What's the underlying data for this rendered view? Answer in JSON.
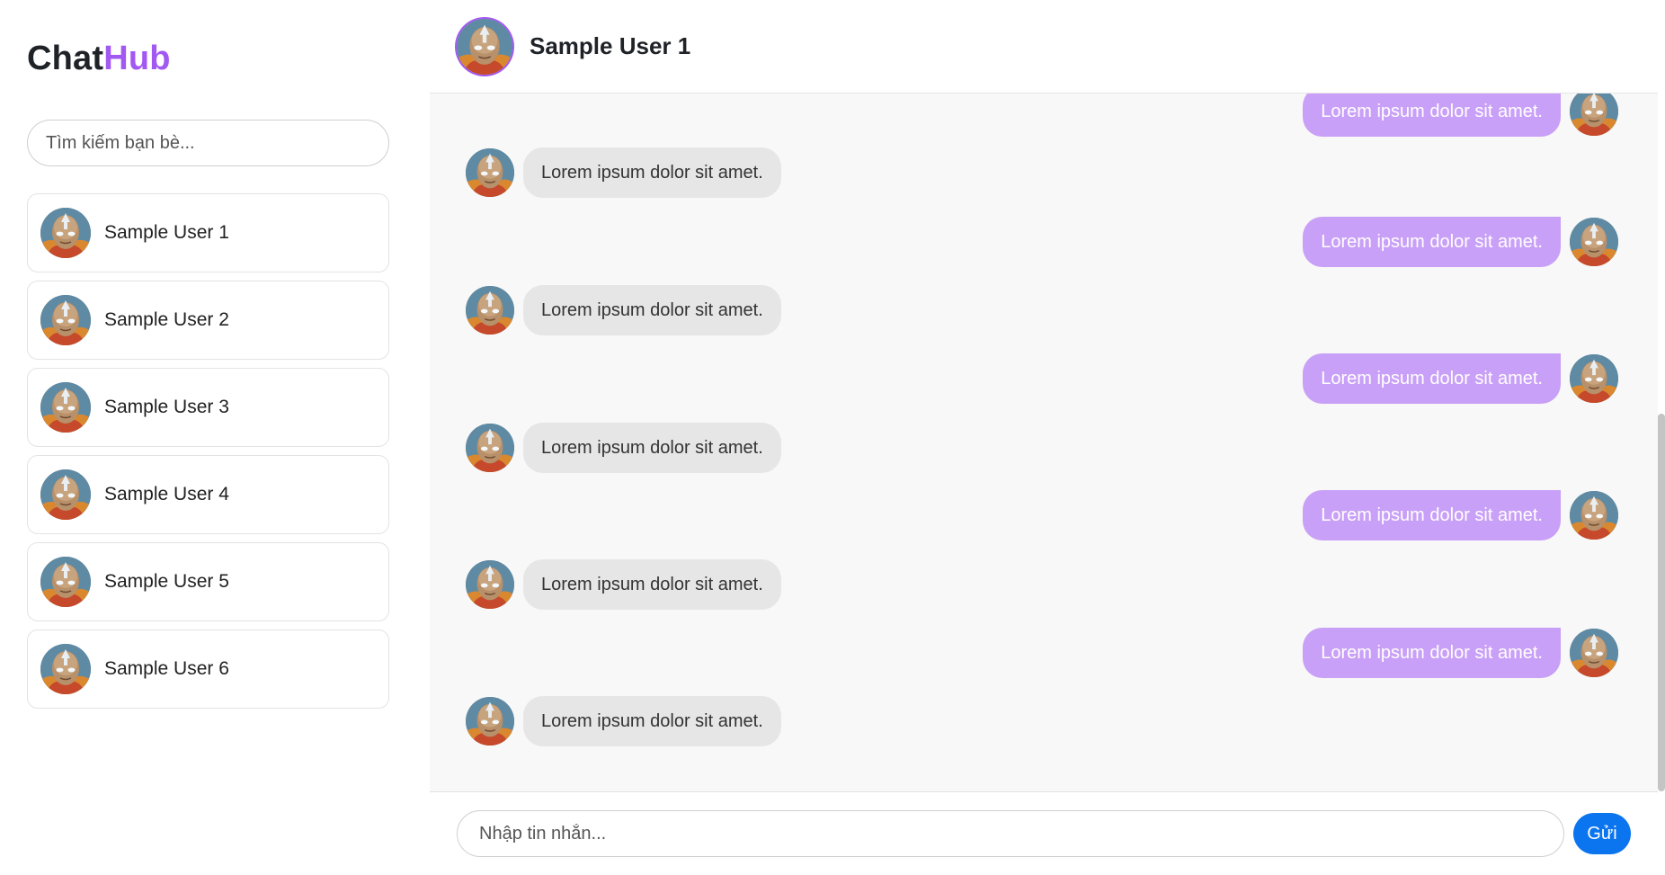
{
  "brand": {
    "part1": "Chat",
    "part2": "Hub"
  },
  "search": {
    "placeholder": "Tìm kiếm bạn bè..."
  },
  "users": [
    {
      "name": "Sample User 1"
    },
    {
      "name": "Sample User 2"
    },
    {
      "name": "Sample User 3"
    },
    {
      "name": "Sample User 4"
    },
    {
      "name": "Sample User 5"
    },
    {
      "name": "Sample User 6"
    }
  ],
  "chat": {
    "title": "Sample User 1",
    "messages": [
      {
        "dir": "out",
        "text": "Lorem ipsum dolor sit amet."
      },
      {
        "dir": "in",
        "text": "Lorem ipsum dolor sit amet."
      },
      {
        "dir": "out",
        "text": "Lorem ipsum dolor sit amet."
      },
      {
        "dir": "in",
        "text": "Lorem ipsum dolor sit amet."
      },
      {
        "dir": "out",
        "text": "Lorem ipsum dolor sit amet."
      },
      {
        "dir": "in",
        "text": "Lorem ipsum dolor sit amet."
      },
      {
        "dir": "out",
        "text": "Lorem ipsum dolor sit amet."
      },
      {
        "dir": "in",
        "text": "Lorem ipsum dolor sit amet."
      },
      {
        "dir": "out",
        "text": "Lorem ipsum dolor sit amet."
      },
      {
        "dir": "in",
        "text": "Lorem ipsum dolor sit amet."
      }
    ]
  },
  "composer": {
    "placeholder": "Nhập tin nhắn...",
    "send_label": "Gửi"
  },
  "colors": {
    "brand_accent": "#a259f2",
    "outgoing_bubble": "#c9a0f7",
    "incoming_bubble": "#e6e6e6",
    "send_button": "#0b74ef"
  }
}
